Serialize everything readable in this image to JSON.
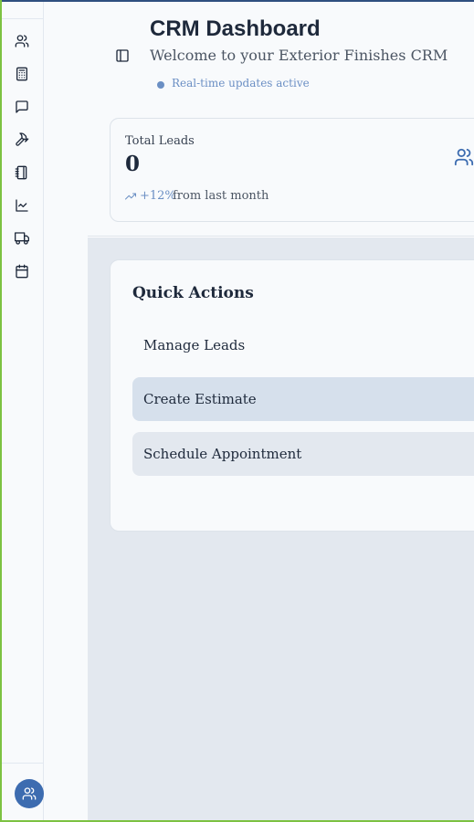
{
  "colors": {
    "accent": "#3d6cb0",
    "frame_green": "#7cc242",
    "status_blue": "#6b8fc4",
    "background": "#e3e8ef"
  },
  "sidebar": {
    "items": [
      {
        "icon": "users-icon"
      },
      {
        "icon": "calculator-icon"
      },
      {
        "icon": "message-icon"
      },
      {
        "icon": "hammer-icon"
      },
      {
        "icon": "notebook-icon"
      },
      {
        "icon": "line-chart-icon"
      },
      {
        "icon": "truck-icon"
      },
      {
        "icon": "calendar-icon"
      }
    ],
    "avatar_icon": "users-icon"
  },
  "header": {
    "title": "CRM Dashboard",
    "subtitle": "Welcome to your Exterior Finishes CRM",
    "status": "Real-time updates active"
  },
  "stats": {
    "total_leads": {
      "label": "Total Leads",
      "value": "0",
      "trend": "+12%",
      "trend_suffix": "from last month",
      "icon": "users-icon"
    }
  },
  "quick_actions": {
    "title": "Quick Actions",
    "actions": [
      {
        "label": "Manage Leads"
      },
      {
        "label": "Create Estimate"
      },
      {
        "label": "Schedule Appointment"
      }
    ]
  }
}
